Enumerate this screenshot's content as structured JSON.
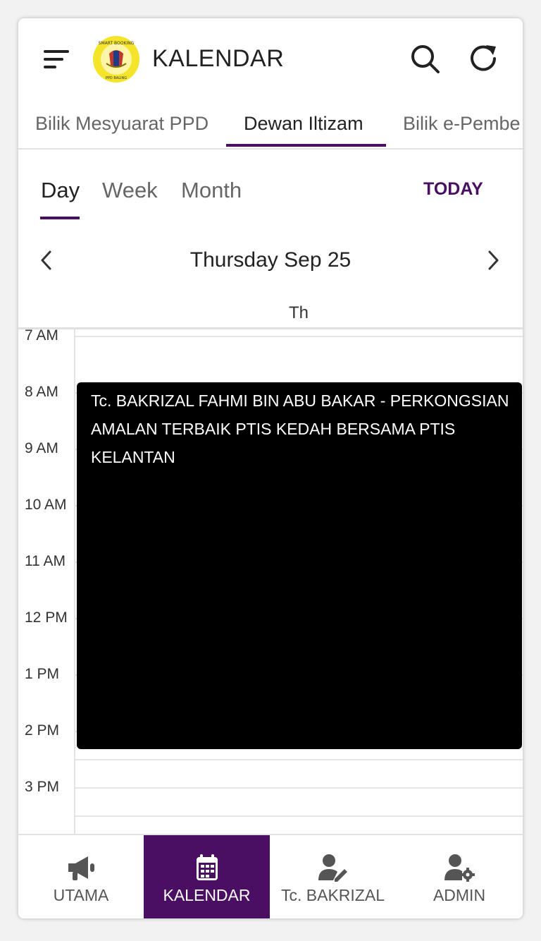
{
  "header": {
    "title": "KALENDAR",
    "logo_text_top": "SMART BOOKING SYSTEM",
    "logo_text_bottom": "PPD BALING"
  },
  "room_tabs": [
    {
      "label": "Bilik Mesyuarat PPD"
    },
    {
      "label": "Dewan Iltizam"
    },
    {
      "label": "Bilik e-Pembe"
    }
  ],
  "view_tabs": [
    {
      "label": "Day"
    },
    {
      "label": "Week"
    },
    {
      "label": "Month"
    }
  ],
  "today_label": "TODAY",
  "date_label": "Thursday Sep 25",
  "day_header": "Th",
  "time_labels": [
    "7 AM",
    "8 AM",
    "9 AM",
    "10 AM",
    "11 AM",
    "12 PM",
    "1 PM",
    "2 PM",
    "3 PM"
  ],
  "event": {
    "title": "Tc. BAKRIZAL FAHMI BIN ABU BAKAR - PERKONGSIAN AMALAN TERBAIK PTIS KEDAH BERSAMA PTIS KELANTAN"
  },
  "bottom_nav": [
    {
      "label": "UTAMA",
      "icon": "megaphone-icon"
    },
    {
      "label": "KALENDAR",
      "icon": "calendar-icon"
    },
    {
      "label": "Tc. BAKRIZAL",
      "icon": "user-edit-icon"
    },
    {
      "label": "ADMIN",
      "icon": "user-cog-icon"
    }
  ],
  "colors": {
    "accent": "#4a0f63",
    "event_bg": "#000000",
    "logo_bg": "#f5e52a"
  }
}
